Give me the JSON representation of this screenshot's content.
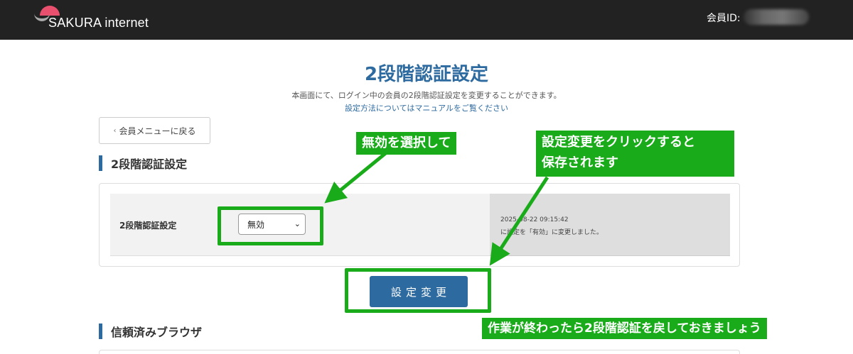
{
  "header": {
    "brand": "SAKURA internet",
    "member_label": "会員ID:"
  },
  "page": {
    "title": "2段階認証設定",
    "description": "本画面にて、ログイン中の会員の2段階認証設定を変更することができます。",
    "manual_link": "設定方法についてはマニュアルをご覧ください",
    "back_label": "会員メニューに戻る"
  },
  "section1": {
    "heading": "2段階認証設定",
    "row_label": "2段階認証設定",
    "select_value": "無効",
    "log_time": "2025-08-22 09:15:42",
    "log_message": "に設定を「有効」に変更しました。"
  },
  "submit": {
    "label": "設定変更"
  },
  "section2": {
    "heading": "信頼済みブラウザ"
  },
  "annotations": {
    "callout_select": "無効を選択して",
    "callout_button_line1": "設定変更をクリックすると",
    "callout_button_line2": "保存されます",
    "callout_bottom": "作業が終わったら2段階認証を戻しておきましょう"
  },
  "colors": {
    "accent": "#2d6a9f",
    "highlight": "#1aab1a",
    "topbar": "#222222"
  }
}
